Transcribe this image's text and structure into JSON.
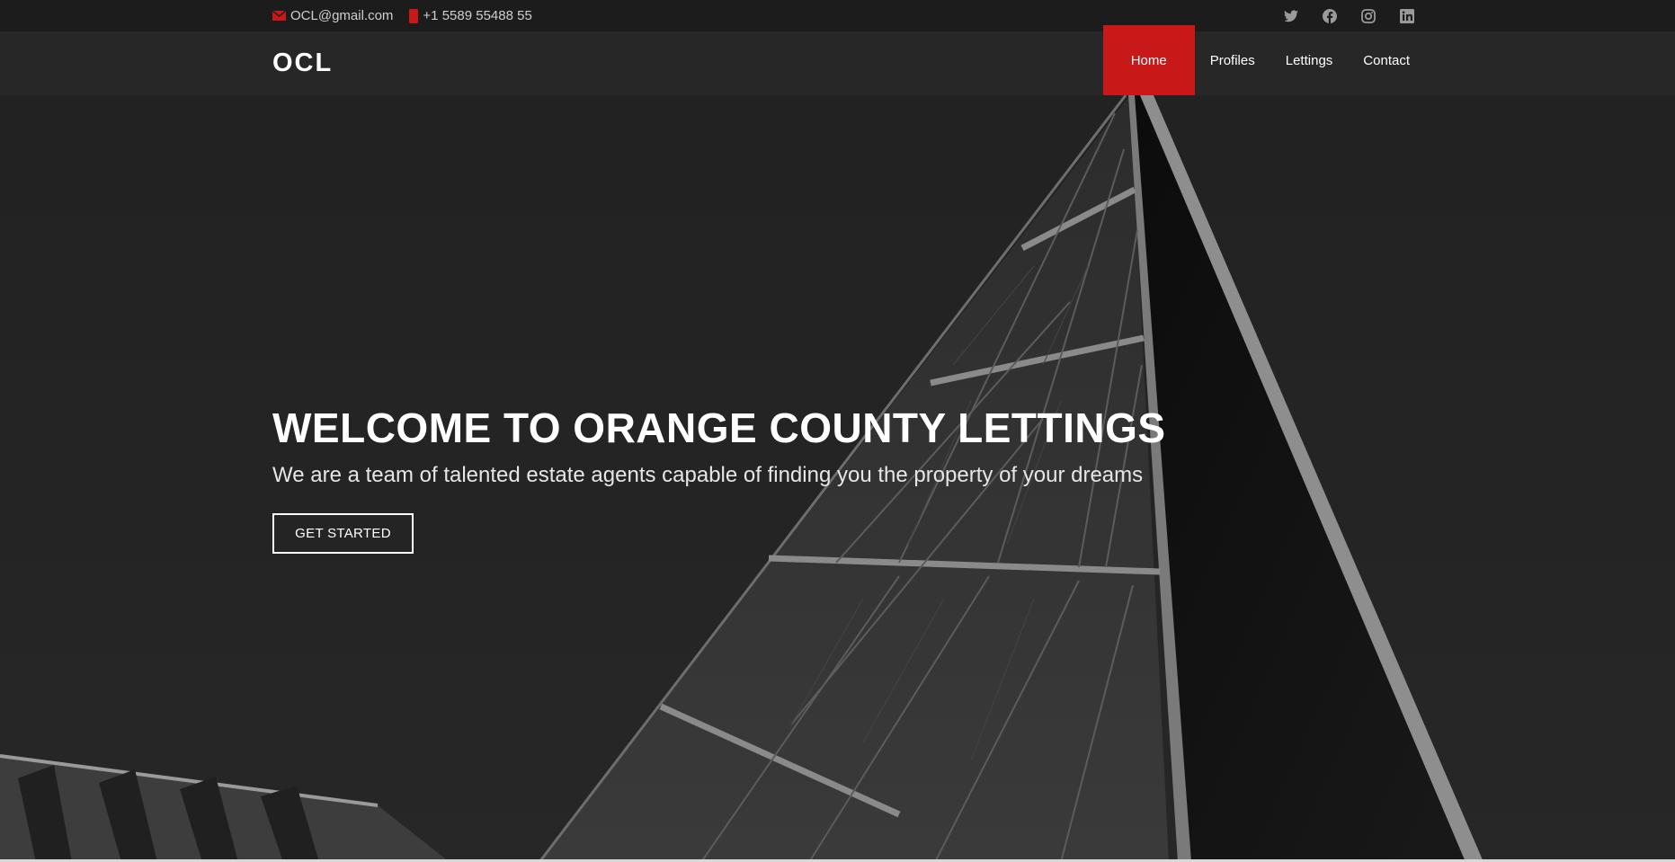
{
  "topbar": {
    "email": "OCL@gmail.com",
    "phone": "+1 5589 55488 55",
    "icons": [
      "envelope-icon",
      "phone-icon",
      "twitter-icon",
      "facebook-icon",
      "instagram-icon",
      "linkedin-icon"
    ]
  },
  "header": {
    "logo": "OCL",
    "nav": [
      "Home",
      "Profiles",
      "Lettings",
      "Contact"
    ],
    "active": "Home"
  },
  "hero": {
    "title": "WELCOME TO ORANGE COUNTY LETTINGS",
    "subtitle": "We are a team of talented estate agents capable of finding you the property of your dreams",
    "cta": "GET STARTED"
  },
  "colors": {
    "accent": "#c81818",
    "background": "#1b1b1b",
    "header": "#272727"
  }
}
